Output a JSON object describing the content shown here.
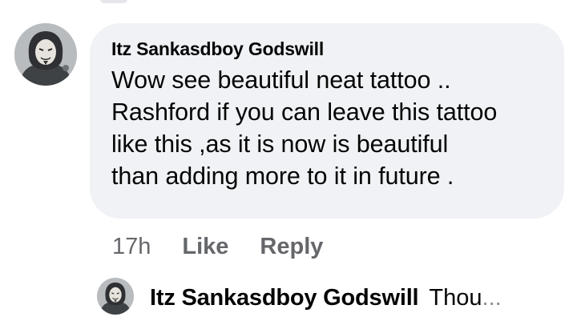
{
  "comment": {
    "author": "Itz Sankasdboy Godswill",
    "text_lines": [
      "Wow see beautiful neat tattoo ..",
      "Rashford if you can leave this tattoo",
      "like this ,as it is now is beautiful",
      "than adding more to it in future ."
    ],
    "time": "17h",
    "like_label": "Like",
    "reply_label": "Reply"
  },
  "reply_preview": {
    "author": "Itz Sankasdboy Godswill",
    "text": "Thou",
    "ellipsis": "..."
  },
  "colors": {
    "bubble_bg": "#f0f2f5",
    "secondary_text": "#65676b",
    "primary_text": "#050505"
  }
}
